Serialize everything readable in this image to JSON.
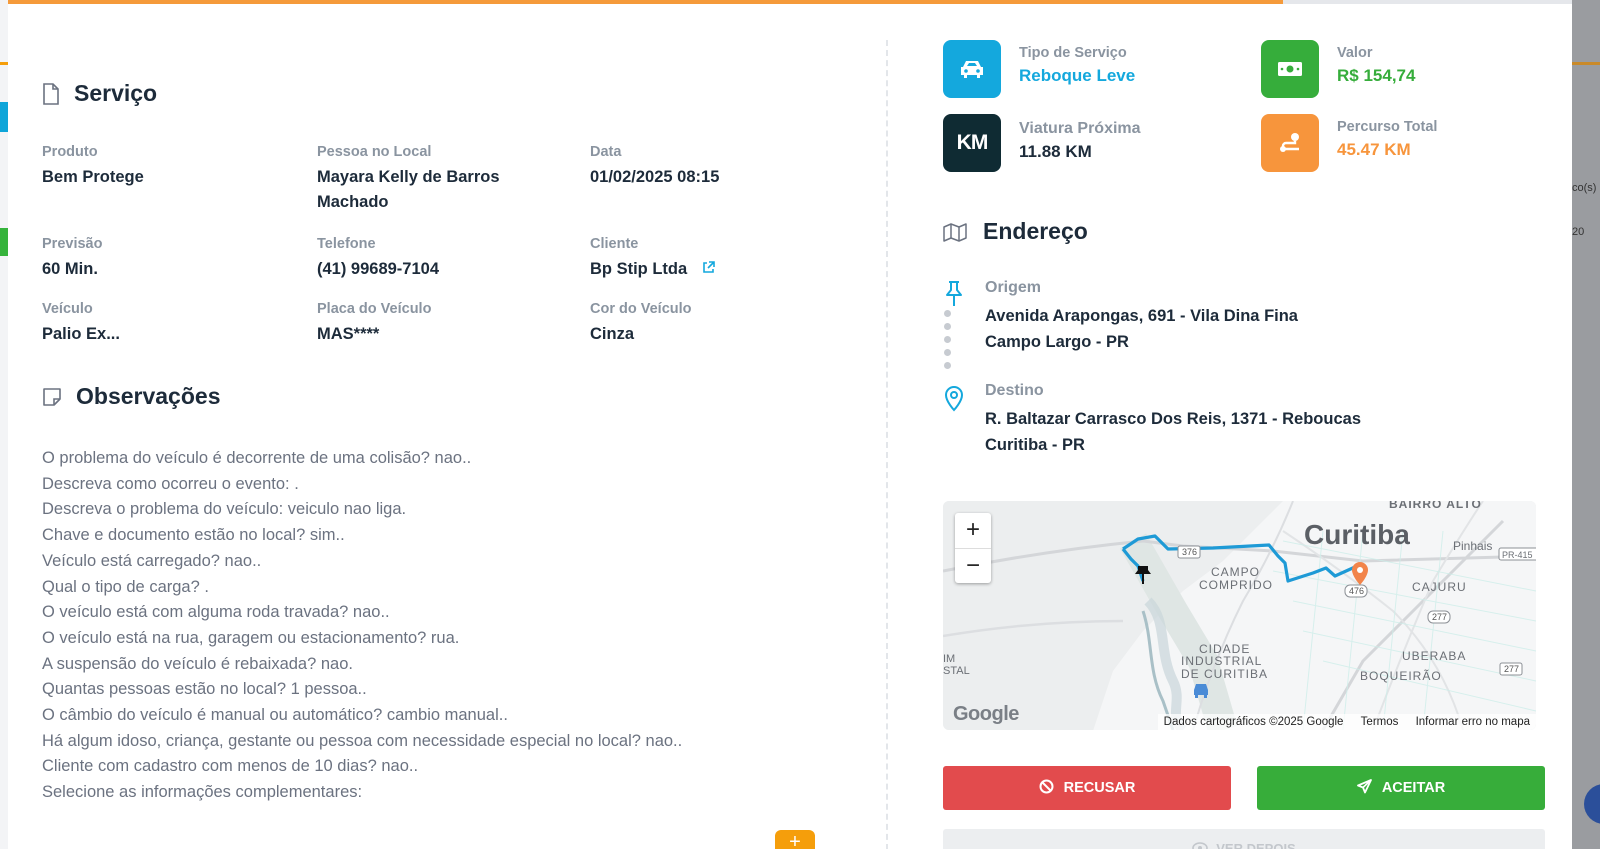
{
  "progress": {
    "value": 0.815
  },
  "service": {
    "title": "Serviço",
    "fields": [
      {
        "label": "Produto",
        "value": "Bem Protege"
      },
      {
        "label": "Pessoa no Local",
        "value": "Mayara Kelly de Barros Machado"
      },
      {
        "label": "Data",
        "value": "01/02/2025 08:15"
      },
      {
        "label": "Previsão",
        "value": "60 Min."
      },
      {
        "label": "Telefone",
        "value": "(41) 99689-7104"
      },
      {
        "label": "Cliente",
        "value": "Bp Stip Ltda"
      },
      {
        "label": "Veículo",
        "value": "Palio Ex..."
      },
      {
        "label": "Placa do Veículo",
        "value": "MAS****"
      },
      {
        "label": "Cor do Veículo",
        "value": "Cinza"
      }
    ]
  },
  "observations": {
    "title": "Observações",
    "lines": [
      "O problema do veículo é decorrente de uma colisão? nao..",
      "Descreva como ocorreu o evento: .",
      "Descreva o problema do veículo: veiculo nao liga.",
      "Chave e documento estão no local? sim..",
      "Veículo está carregado? nao..",
      "Qual o tipo de carga? .",
      "O veículo está com alguma roda travada? nao..",
      "O veículo está na rua, garagem ou estacionamento? rua.",
      "A suspensão do veículo é rebaixada? nao.",
      "Quantas pessoas estão no local? 1 pessoa..",
      "O câmbio do veículo é manual ou automático? cambio manual..",
      "Há algum idoso, criança, gestante ou pessoa com necessidade especial no local? nao..",
      "Cliente com cadastro com menos de 10 dias? nao..",
      "Selecione as informações complementares:"
    ],
    "add_label": "+"
  },
  "stats": {
    "service_type": {
      "label": "Tipo de Serviço",
      "value": "Reboque Leve",
      "color": "#14a8dd"
    },
    "value": {
      "label": "Valor",
      "value": "R$ 154,74",
      "color": "#36ad3b"
    },
    "nearby": {
      "label": "Viatura Próxima",
      "value": "11.88 KM",
      "icon_text": "KM",
      "color": "#0f2b33"
    },
    "route": {
      "label": "Percurso Total",
      "value": "45.47 KM",
      "color": "#f7953c"
    }
  },
  "address": {
    "title": "Endereço",
    "origin": {
      "label": "Origem",
      "line1": "Avenida Arapongas, 691 - Vila Dina Fina",
      "line2": "Campo Largo - PR"
    },
    "destination": {
      "label": "Destino",
      "line1": "R. Baltazar Carrasco Dos Reis, 1371 - Reboucas",
      "line2": "Curitiba - PR"
    }
  },
  "map": {
    "zoom_in": "+",
    "zoom_out": "−",
    "labels": {
      "curitiba": "Curitiba",
      "bairro_alto": "BAIRRO ALTO",
      "pinhais": "Pinhais",
      "pr415": "PR-415",
      "campo_comprido_1": "CAMPO",
      "campo_comprido_2": "COMPRIDO",
      "cajuru": "CAJURU",
      "cidade_ind_1": "CIDADE",
      "cidade_ind_2": "INDUSTRIAL",
      "cidade_ind_3": "DE CURITIBA",
      "uberaba": "UBERABA",
      "boqueirao": "BOQUEIRÃO",
      "r376": "376",
      "r476": "476",
      "r277": "277",
      "r277b": "277",
      "im": "IM",
      "stal": "STAL"
    },
    "google": "Google",
    "attribution": "Dados cartográficos ©2025 Google",
    "terms": "Termos",
    "report": "Informar erro no mapa"
  },
  "actions": {
    "refuse": "RECUSAR",
    "accept": "ACEITAR",
    "later": "VER DEPOIS"
  },
  "background": {
    "right_text_1": "co(s)",
    "right_text_2": "20"
  }
}
